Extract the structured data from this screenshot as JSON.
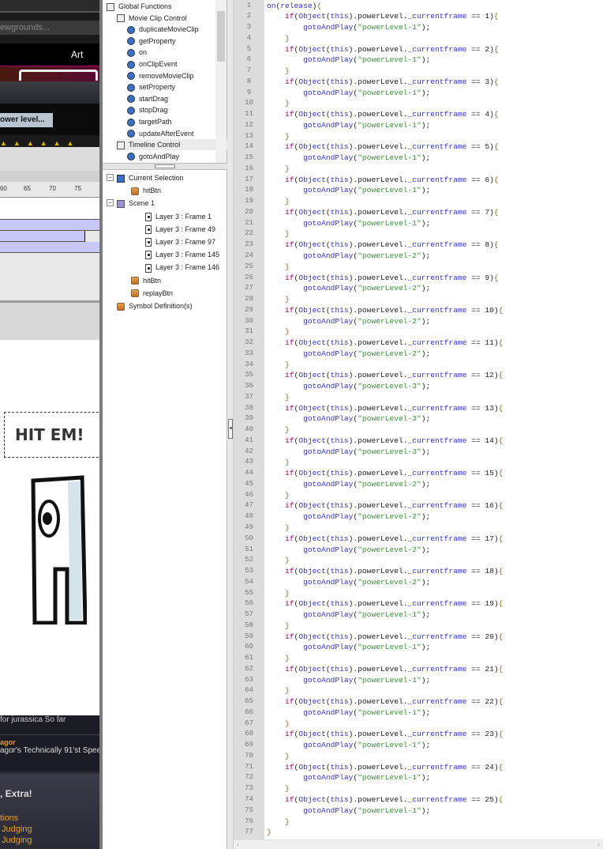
{
  "browser": {
    "address_partial": "ewgrounds...",
    "nav_art": "Art",
    "button_partial": "ower level..."
  },
  "timeline": {
    "ruler": [
      "60",
      "65",
      "70",
      "75"
    ]
  },
  "stage": {
    "hit_text": "HIT EM!"
  },
  "feed": {
    "item1": "for jurassica So far",
    "author2": "agor",
    "item2": "agor's Technically 91'st Speech",
    "heading": ", Extra!",
    "links": [
      "tions",
      "Judging",
      "Judging"
    ]
  },
  "actions_toolbox": {
    "items": [
      {
        "label": "Global Functions",
        "type": "book",
        "level": 0
      },
      {
        "label": "Movie Clip Control",
        "type": "book",
        "level": 1
      },
      {
        "label": "duplicateMovieClip",
        "type": "fn",
        "level": 2
      },
      {
        "label": "getProperty",
        "type": "fn",
        "level": 2
      },
      {
        "label": "on",
        "type": "fn",
        "level": 2
      },
      {
        "label": "onClipEvent",
        "type": "fn",
        "level": 2
      },
      {
        "label": "removeMovieClip",
        "type": "fn",
        "level": 2
      },
      {
        "label": "setProperty",
        "type": "fn",
        "level": 2
      },
      {
        "label": "startDrag",
        "type": "fn",
        "level": 2
      },
      {
        "label": "stopDrag",
        "type": "fn",
        "level": 2
      },
      {
        "label": "targetPath",
        "type": "fn",
        "level": 2
      },
      {
        "label": "updateAfterEvent",
        "type": "fn",
        "level": 2
      },
      {
        "label": "Timeline Control",
        "type": "book",
        "level": 1
      },
      {
        "label": "gotoAndPlay",
        "type": "fn",
        "level": 2
      }
    ]
  },
  "script_navigator": {
    "items": [
      {
        "label": "Current Selection",
        "type": "sel",
        "level": 0,
        "expander": "−"
      },
      {
        "label": "hitBtn",
        "type": "btn",
        "level": 1
      },
      {
        "label": "Scene 1",
        "type": "scene",
        "level": 0,
        "expander": "−"
      },
      {
        "label": "Layer 3 : Frame 1",
        "type": "frm",
        "level": 2
      },
      {
        "label": "Layer 3 : Frame 49",
        "type": "frm",
        "level": 2
      },
      {
        "label": "Layer 3 : Frame 97",
        "type": "frm",
        "level": 2
      },
      {
        "label": "Layer 3 : Frame 145",
        "type": "frm",
        "level": 2
      },
      {
        "label": "Layer 3 : Frame 146",
        "type": "frm",
        "level": 2
      },
      {
        "label": "hitBtn",
        "type": "btn",
        "level": 1
      },
      {
        "label": "replayBtn",
        "type": "btn",
        "level": 1
      },
      {
        "label": "Symbol Definition(s)",
        "type": "sym",
        "level": 0
      }
    ]
  },
  "code": {
    "header": "on(release){",
    "conditions": [
      {
        "frame": 1,
        "target": "powerLevel-1"
      },
      {
        "frame": 2,
        "target": "powerLevel-1"
      },
      {
        "frame": 3,
        "target": "powerLevel-1"
      },
      {
        "frame": 4,
        "target": "powerLevel-1"
      },
      {
        "frame": 5,
        "target": "powerLevel-1"
      },
      {
        "frame": 6,
        "target": "powerLevel-1"
      },
      {
        "frame": 7,
        "target": "powerLevel-1"
      },
      {
        "frame": 8,
        "target": "powerLevel-2"
      },
      {
        "frame": 9,
        "target": "powerLevel-2"
      },
      {
        "frame": 10,
        "target": "powerLevel-2"
      },
      {
        "frame": 11,
        "target": "powerLevel-2"
      },
      {
        "frame": 12,
        "target": "powerLevel-3"
      },
      {
        "frame": 13,
        "target": "powerLevel-3"
      },
      {
        "frame": 14,
        "target": "powerLevel-3"
      },
      {
        "frame": 15,
        "target": "powerLevel-2"
      },
      {
        "frame": 16,
        "target": "powerLevel-2"
      },
      {
        "frame": 17,
        "target": "powerLevel-2"
      },
      {
        "frame": 18,
        "target": "powerLevel-2"
      },
      {
        "frame": 19,
        "target": "powerLevel-1"
      },
      {
        "frame": 20,
        "target": "powerLevel-1"
      },
      {
        "frame": 21,
        "target": "powerLevel-1"
      },
      {
        "frame": 22,
        "target": "powerLevel-1"
      },
      {
        "frame": 23,
        "target": "powerLevel-1"
      },
      {
        "frame": 24,
        "target": "powerLevel-1"
      },
      {
        "frame": 25,
        "target": "powerLevel-1"
      }
    ],
    "footer": "}",
    "lines": []
  },
  "colors": {
    "keyword": "#990066",
    "builtin": "#3333cc",
    "string": "#339933",
    "timeline_fill": "#c8c8f8"
  }
}
